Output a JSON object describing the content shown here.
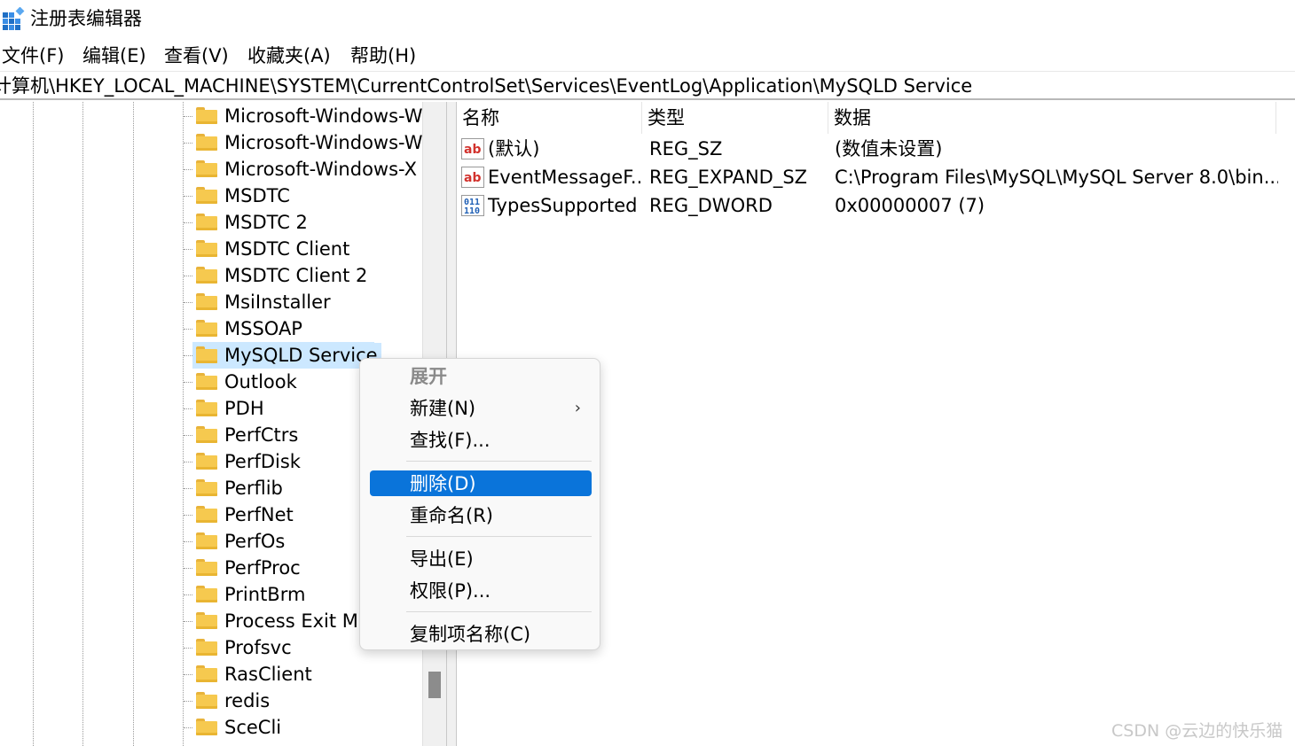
{
  "window": {
    "title": "注册表编辑器",
    "app_icon": "registry-editor-icon"
  },
  "menu": [
    "文件(F)",
    "编辑(E)",
    "查看(V)",
    "收藏夹(A)",
    "帮助(H)"
  ],
  "address": "计算机\\HKEY_LOCAL_MACHINE\\SYSTEM\\CurrentControlSet\\Services\\EventLog\\Application\\MySQLD Service",
  "tree": {
    "items": [
      "Microsoft-Windows-W",
      "Microsoft-Windows-W",
      "Microsoft-Windows-X",
      "MSDTC",
      "MSDTC 2",
      "MSDTC Client",
      "MSDTC Client 2",
      "MsiInstaller",
      "MSSOAP",
      "MySQLD Service",
      "Outlook",
      "PDH",
      "PerfCtrs",
      "PerfDisk",
      "Perflib",
      "PerfNet",
      "PerfOs",
      "PerfProc",
      "PrintBrm",
      "Process Exit Mo",
      "Profsvc",
      "RasClient",
      "redis",
      "SceCli"
    ],
    "selected": "MySQLD Service",
    "icon": "folder-icon"
  },
  "list": {
    "columns": [
      "名称",
      "类型",
      "数据"
    ],
    "rows": [
      {
        "icon": "string-value-icon",
        "name": "(默认)",
        "type": "REG_SZ",
        "data": "(数值未设置)"
      },
      {
        "icon": "string-value-icon",
        "name": "EventMessageF...",
        "type": "REG_EXPAND_SZ",
        "data": "C:\\Program Files\\MySQL\\MySQL Server 8.0\\bin..."
      },
      {
        "icon": "binary-value-icon",
        "name": "TypesSupported",
        "type": "REG_DWORD",
        "data": "0x00000007 (7)"
      }
    ]
  },
  "context_menu": {
    "items": [
      {
        "label": "展开",
        "state": "disabled"
      },
      {
        "label": "新建(N)",
        "submenu": true,
        "arrow": "›"
      },
      {
        "label": "查找(F)..."
      },
      {
        "label": "删除(D)",
        "state": "highlighted"
      },
      {
        "label": "重命名(R)"
      },
      {
        "label": "导出(E)"
      },
      {
        "label": "权限(P)..."
      },
      {
        "label": "复制项名称(C)"
      }
    ]
  },
  "watermark": "CSDN @云边的快乐猫",
  "colors": {
    "highlight": "#0a74da",
    "selection": "#cce8ff",
    "folder": "#f6c94f"
  }
}
